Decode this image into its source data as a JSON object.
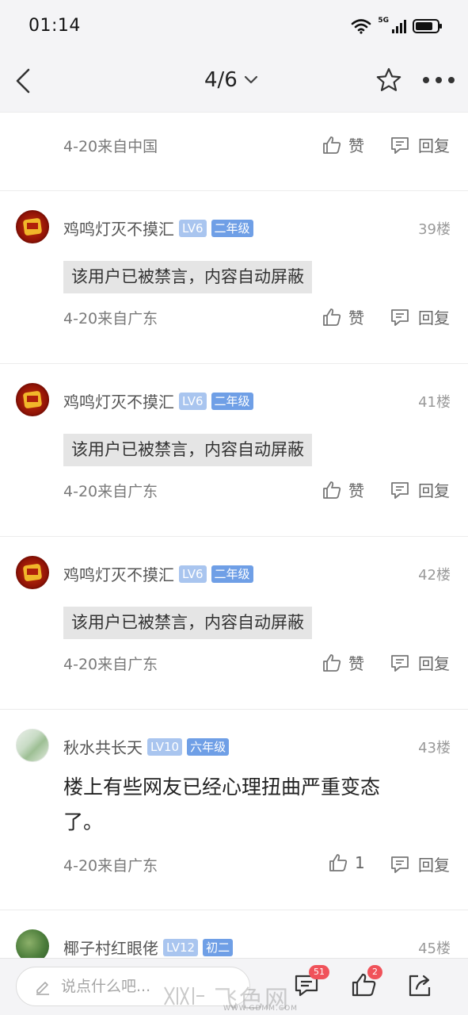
{
  "status_bar": {
    "time": "01:14",
    "network": "5G",
    "battery_level": 0.8
  },
  "nav": {
    "page_indicator": "4/6"
  },
  "actions": {
    "like_label": "赞",
    "reply_label": "回复"
  },
  "posts": [
    {
      "meta": "4-20来自中国"
    },
    {
      "username": "鸡鸣灯灭不摸汇",
      "level": "LV6",
      "grade": "二年级",
      "floor": "39楼",
      "content": "该用户已被禁言，内容自动屏蔽",
      "meta": "4-20来自广东"
    },
    {
      "username": "鸡鸣灯灭不摸汇",
      "level": "LV6",
      "grade": "二年级",
      "floor": "41楼",
      "content": "该用户已被禁言，内容自动屏蔽",
      "meta": "4-20来自广东"
    },
    {
      "username": "鸡鸣灯灭不摸汇",
      "level": "LV6",
      "grade": "二年级",
      "floor": "42楼",
      "content": "该用户已被禁言，内容自动屏蔽",
      "meta": "4-20来自广东"
    },
    {
      "username": "秋水共长天",
      "level": "LV10",
      "grade": "六年级",
      "floor": "43楼",
      "content_line1": "楼上有些网友已经心理扭曲严重变态",
      "content_line2": "了。",
      "meta": "4-20来自广东",
      "like_count": "1"
    },
    {
      "username": "椰子村红眼佬",
      "level": "LV12",
      "grade": "初二",
      "floor": "45楼"
    }
  ],
  "bottom_bar": {
    "input_placeholder": "说点什么吧...",
    "comment_count": "51",
    "like_count": "2",
    "watermark_logo": "飞色网",
    "watermark_url": "WWW.GDMM.COM"
  }
}
